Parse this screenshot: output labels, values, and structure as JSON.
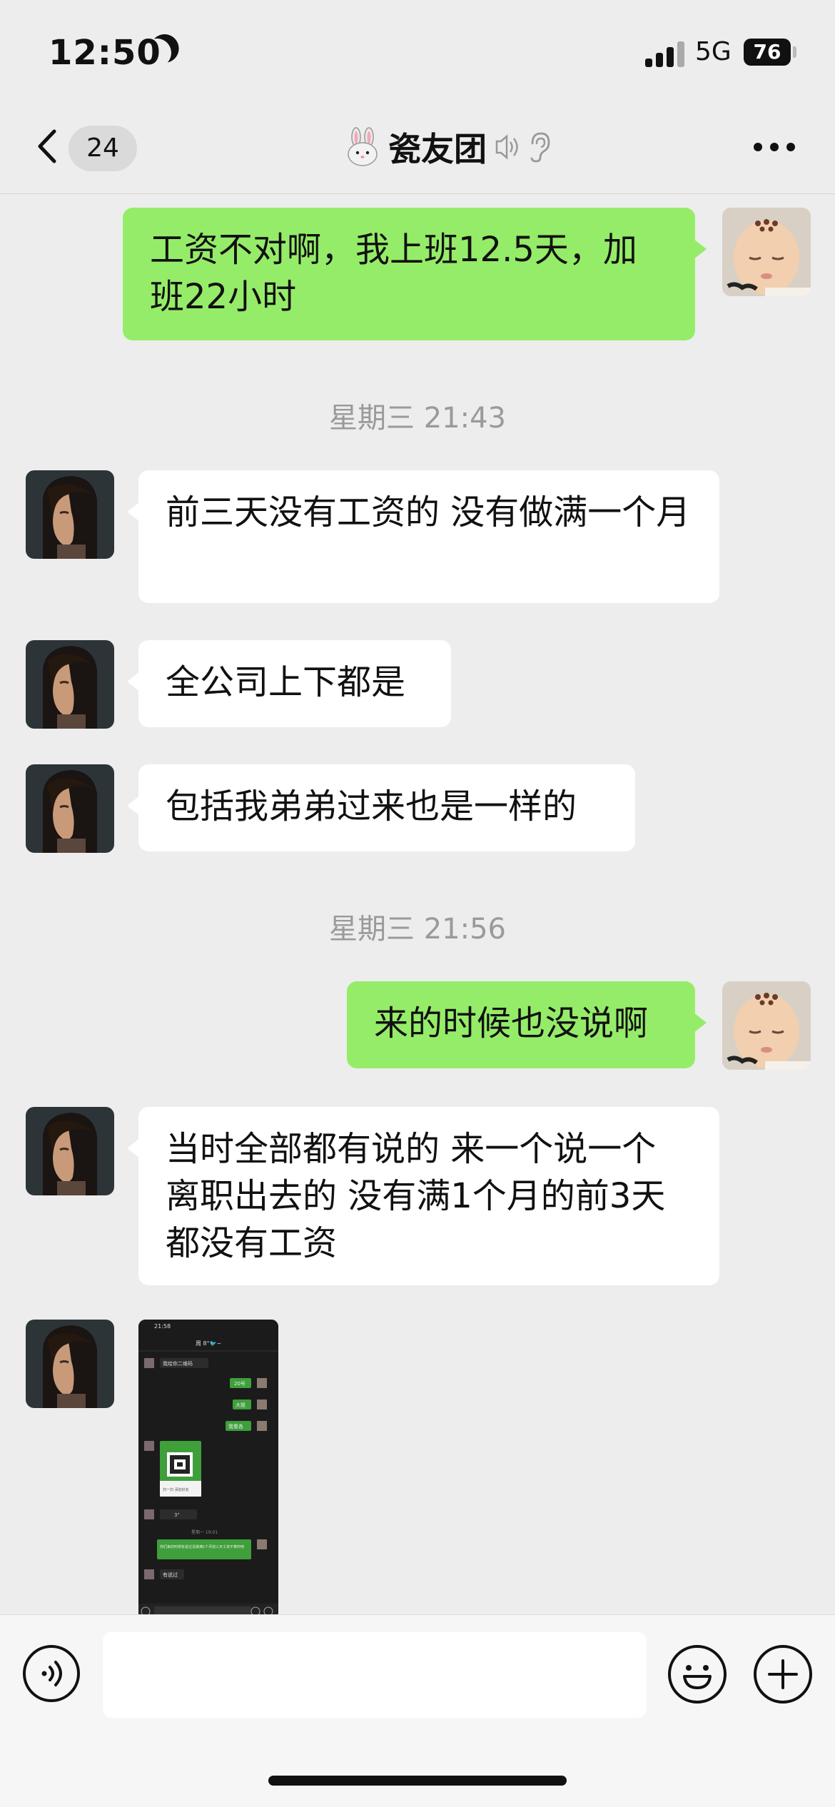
{
  "status_bar": {
    "time": "12:50",
    "network": "5G",
    "battery": "76"
  },
  "nav": {
    "back_count": "24",
    "title": "瓷友团"
  },
  "messages": [
    {
      "from": "me",
      "text": "工资不对啊，我上班12.5天，加班22小时"
    },
    {
      "type": "timestamp",
      "text": "星期三 21:43"
    },
    {
      "from": "other",
      "text": "前三天没有工资的 没有做满一个月"
    },
    {
      "from": "other",
      "text": "全公司上下都是"
    },
    {
      "from": "other",
      "text": "包括我弟弟过来也是一样的"
    },
    {
      "type": "timestamp",
      "text": "星期三 21:56"
    },
    {
      "from": "me",
      "text": "来的时候也没说啊"
    },
    {
      "from": "other",
      "text": "当时全部都有说的 来一个说一个 离职出去的 没有满1个月的前3天都没有工资"
    },
    {
      "from": "other",
      "type": "image",
      "text": ""
    }
  ],
  "embedded_screenshot": {
    "time": "21:58",
    "title": "周 8°🐦~",
    "lines": [
      "我给你二维码",
      "20号",
      "大姐",
      "我看各",
      "扫一扫 添加好友",
      "3\"",
      "星期一 19:01",
      "你们来的时候有说过没做满1个月前三天工资不算的吧",
      "有说过"
    ]
  },
  "input": {
    "placeholder": ""
  },
  "colors": {
    "my_bubble": "#95ec69",
    "other_bubble": "#ffffff",
    "background": "#ededed"
  }
}
